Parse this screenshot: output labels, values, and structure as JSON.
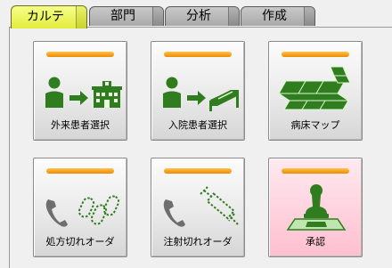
{
  "tabs": [
    {
      "label": "カルテ",
      "active": true
    },
    {
      "label": "部門",
      "active": false
    },
    {
      "label": "分析",
      "active": false
    },
    {
      "label": "作成",
      "active": false
    }
  ],
  "tiles": [
    {
      "label": "外来患者選択",
      "icon": "outpatient-select-icon"
    },
    {
      "label": "入院患者選択",
      "icon": "inpatient-select-icon"
    },
    {
      "label": "病床マップ",
      "icon": "bed-map-icon"
    },
    {
      "label": "処方切れオーダ",
      "icon": "prescription-expiry-icon"
    },
    {
      "label": "注射切れオーダ",
      "icon": "injection-expiry-icon"
    },
    {
      "label": "承認",
      "icon": "approval-stamp-icon"
    }
  ],
  "colors": {
    "active_tab": "#e9f34e",
    "tab": "#b8b8b8",
    "indicator_bar": "#f5a000",
    "icon_green": "#2f7d1e",
    "icon_gray": "#6e6e6e",
    "approval_tile": "#ffd2de"
  }
}
